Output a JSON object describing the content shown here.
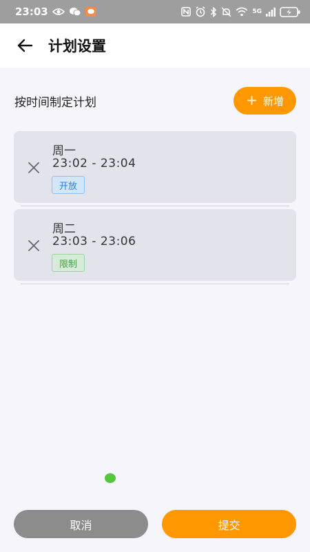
{
  "status_bar": {
    "time": "23:03",
    "network": "5G"
  },
  "header": {
    "title": "计划设置"
  },
  "section": {
    "title": "按时间制定计划",
    "add_label": "新增"
  },
  "plans": [
    {
      "day": "周一",
      "time_range": "23:02 - 23:04",
      "status": "开放",
      "status_color": "#2D7FD8"
    },
    {
      "day": "周二",
      "time_range": "23:03 - 23:06",
      "status": "限制",
      "status_color": "#43A047"
    }
  ],
  "footer": {
    "cancel_label": "取消",
    "submit_label": "提交"
  },
  "colors": {
    "accent": "#FF9800",
    "cancel": "#8C8C8C",
    "indicator": "#53C63D"
  }
}
